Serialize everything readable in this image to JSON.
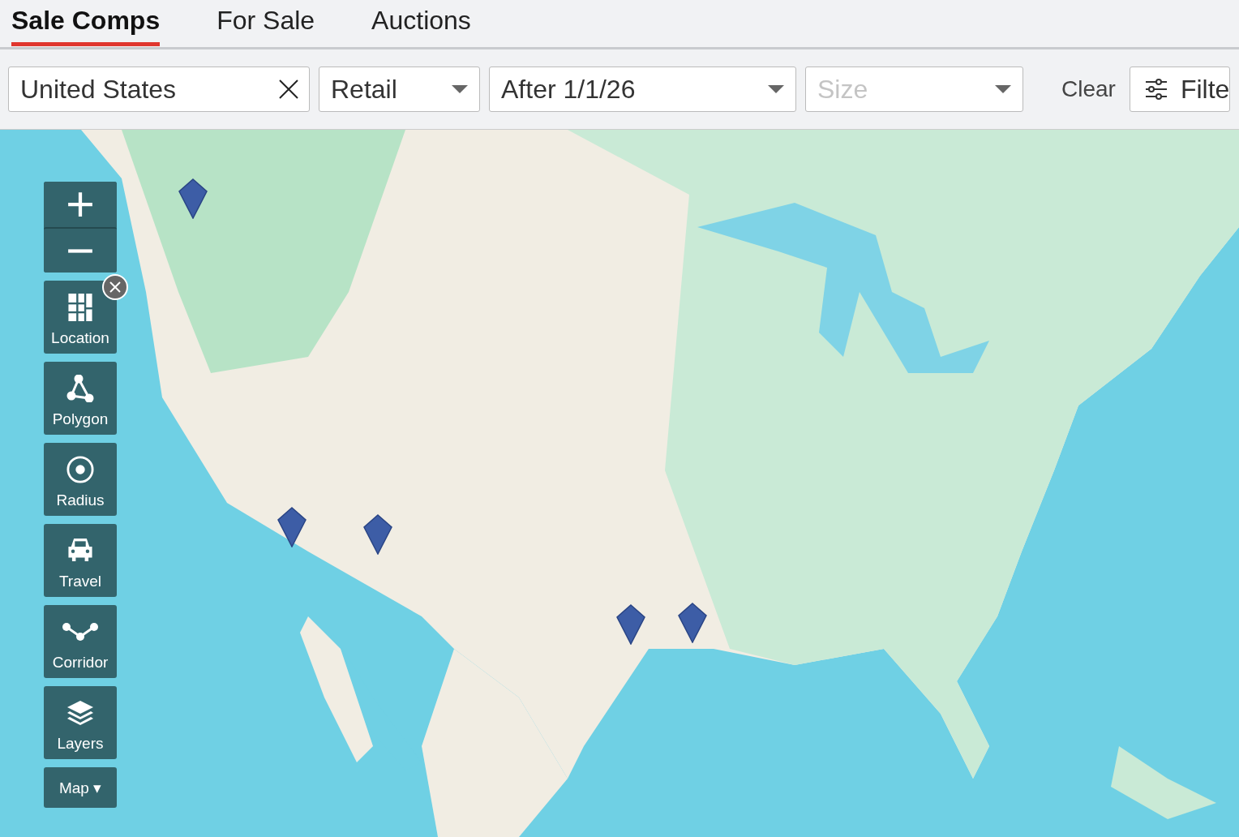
{
  "tabs": [
    {
      "label": "Sale Comps",
      "selected": true
    },
    {
      "label": "For Sale",
      "selected": false
    },
    {
      "label": "Auctions",
      "selected": false
    }
  ],
  "filters": {
    "location": {
      "value": "United States"
    },
    "type": {
      "value": "Retail"
    },
    "date": {
      "value": "After 1/1/26"
    },
    "size": {
      "placeholder": "Size"
    },
    "clear": "Clear",
    "more": "Filte"
  },
  "map": {
    "kind": "picture",
    "tools": [
      {
        "label": "Location",
        "removable": true
      },
      {
        "label": "Polygon",
        "removable": false
      },
      {
        "label": "Radius",
        "removable": false
      },
      {
        "label": "Travel",
        "removable": false
      },
      {
        "label": "Corridor",
        "removable": false
      },
      {
        "label": "Layers",
        "removable": false
      }
    ],
    "map_type": {
      "label": "Map",
      "caret": "▾"
    },
    "markers": [
      {
        "kind": "pin"
      },
      {
        "kind": "pin"
      },
      {
        "kind": "pin"
      },
      {
        "kind": "pin"
      },
      {
        "kind": "pin"
      }
    ]
  }
}
